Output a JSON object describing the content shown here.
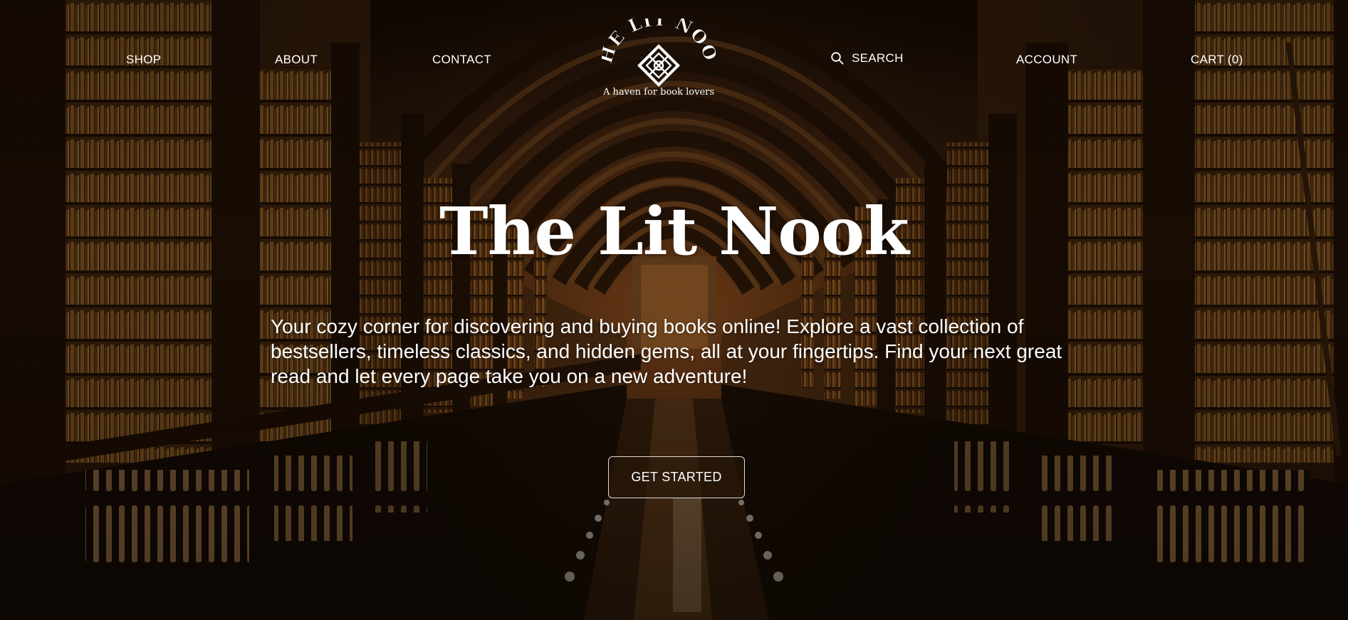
{
  "nav": {
    "shop": "SHOP",
    "about": "ABOUT",
    "contact": "CONTACT",
    "search": "SEARCH",
    "account": "ACCOUNT",
    "cart": "CART (0)"
  },
  "logo": {
    "tagline": "A haven for book lovers"
  },
  "hero": {
    "title": "The Lit Nook",
    "description": "Your cozy corner for discovering and buying books online! Explore a vast collection of bestsellers, timeless classics, and hidden gems, all at your fingertips. Find your next great read and let every page take you on a new adventure!",
    "cta_label": "GET STARTED"
  },
  "icons": {
    "search": "search-icon",
    "logo_mark": "celtic-knot-icon"
  },
  "colors": {
    "wood_dark": "#2a1708",
    "wood_mid": "#6b3d16",
    "book_gold": "#c9862f",
    "text": "#ffffff"
  }
}
